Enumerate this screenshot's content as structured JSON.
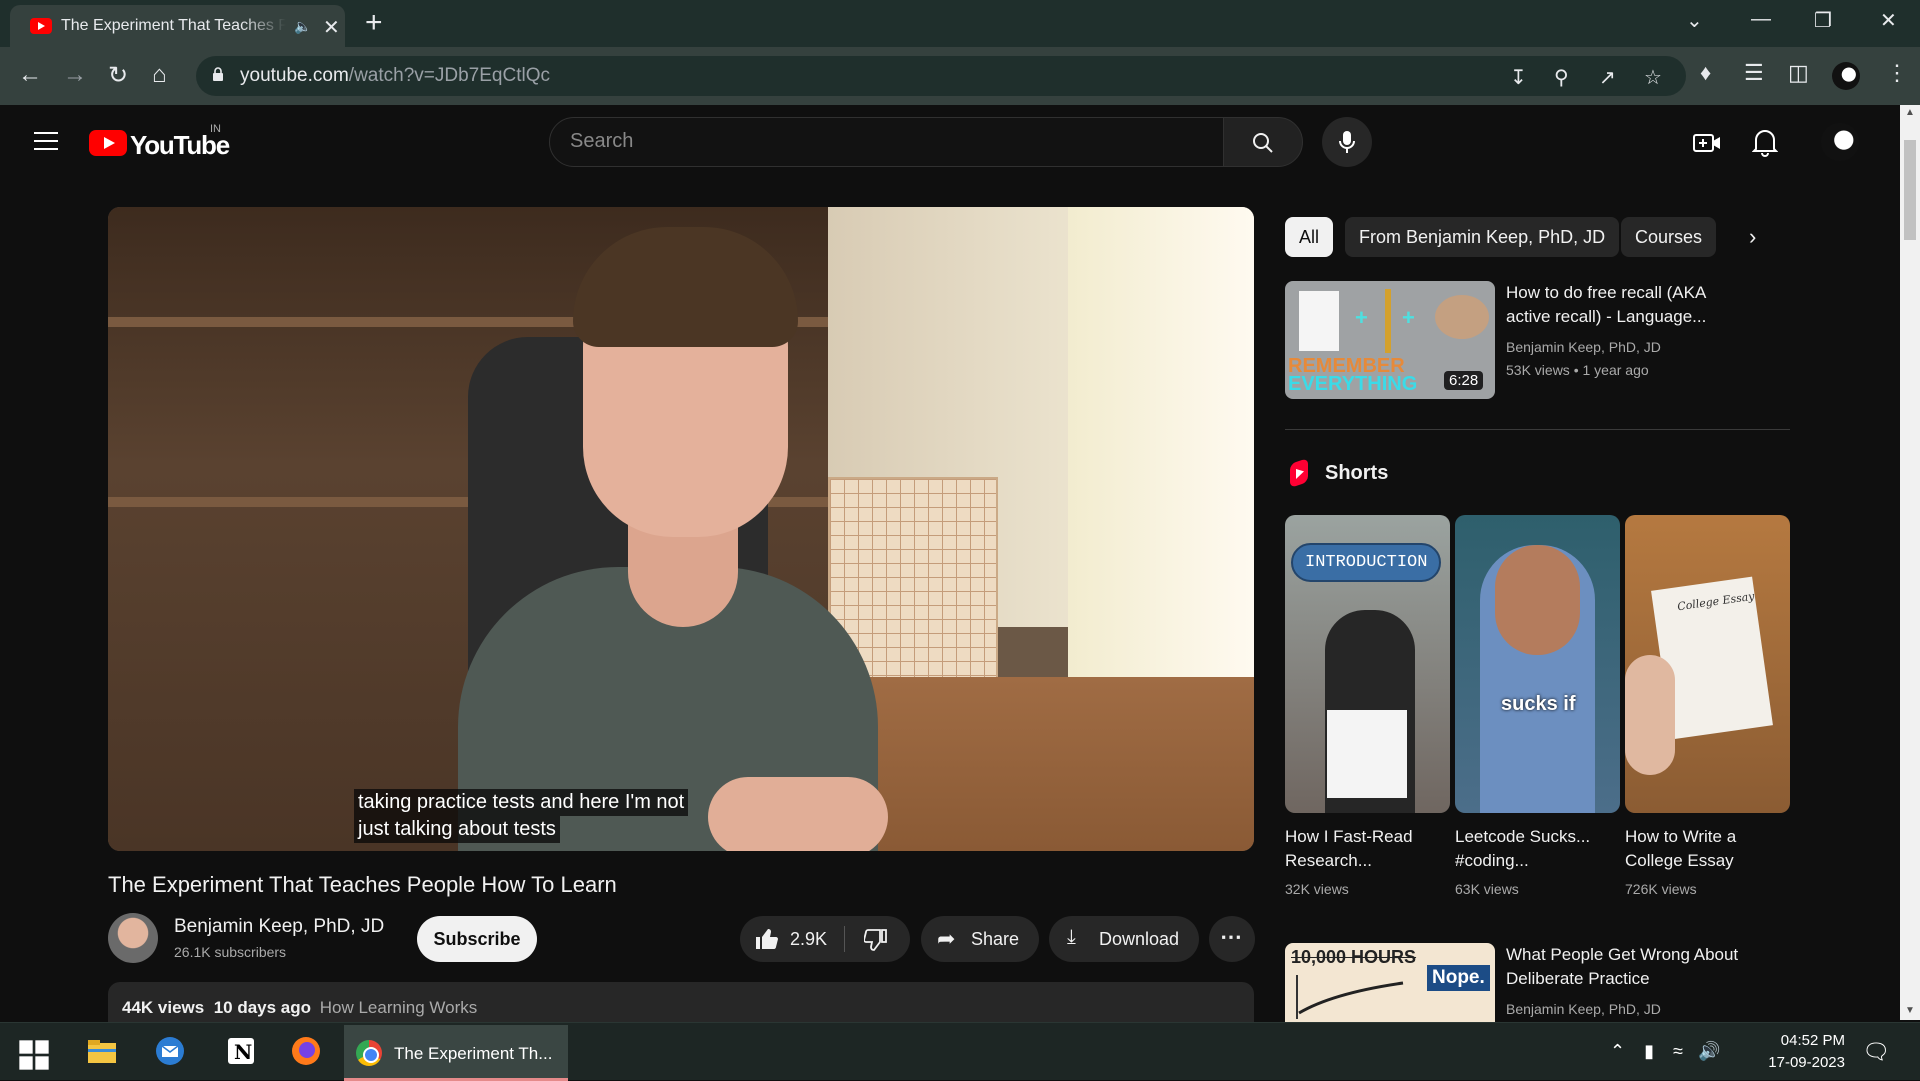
{
  "browser": {
    "tab_title": "The Experiment That Teaches People How To Learn",
    "url_host": "youtube.com",
    "url_path": "/watch?v=JDb7EqCtlQc"
  },
  "youtube": {
    "logo_text": "YouTube",
    "country_code": "IN",
    "search_placeholder": "Search"
  },
  "video": {
    "caption_line1": "taking practice tests and here I'm not",
    "caption_line2": "just talking about tests",
    "title": "The Experiment That Teaches People How To Learn",
    "channel_name": "Benjamin Keep, PhD, JD",
    "subscribers": "26.1K subscribers",
    "subscribe_label": "Subscribe",
    "likes": "2.9K",
    "share_label": "Share",
    "download_label": "Download",
    "views": "44K views",
    "age": "10 days ago",
    "tag": "How Learning Works"
  },
  "filters": {
    "chips": [
      "All",
      "From Benjamin Keep, PhD, JD",
      "Courses"
    ]
  },
  "recommendations": [
    {
      "title_line1": "How to do free recall (AKA",
      "title_line2": "active recall) - Language...",
      "channel": "Benjamin Keep, PhD, JD",
      "views": "53K views",
      "age": "1 year ago",
      "duration": "6:28",
      "thumb_text1": "REMEMBER",
      "thumb_text2": "EVERYTHING"
    },
    {
      "title_line1": "What People Get Wrong About",
      "title_line2": "Deliberate Practice",
      "channel": "Benjamin Keep, PhD, JD",
      "thumb_text1": "10,000 HOURS",
      "thumb_text2": "Nope."
    }
  ],
  "shorts": {
    "heading": "Shorts",
    "items": [
      {
        "title_line1": "How I Fast-Read",
        "title_line2": "Research...",
        "views": "32K views",
        "thumb_text": "INTRODUCTION"
      },
      {
        "title_line1": "Leetcode Sucks...",
        "title_line2": "#coding...",
        "views": "63K views",
        "thumb_text": "sucks if"
      },
      {
        "title_line1": "How to Write a",
        "title_line2": "College Essay",
        "views": "726K views",
        "thumb_text": "College Essay"
      }
    ]
  },
  "taskbar": {
    "chrome_label": "The Experiment Th...",
    "time": "04:52 PM",
    "date": "17-09-2023"
  },
  "colors": {
    "brand_red": "#ff0000",
    "background": "#0f0f0f",
    "chrome_frame": "#1f2f2c"
  }
}
